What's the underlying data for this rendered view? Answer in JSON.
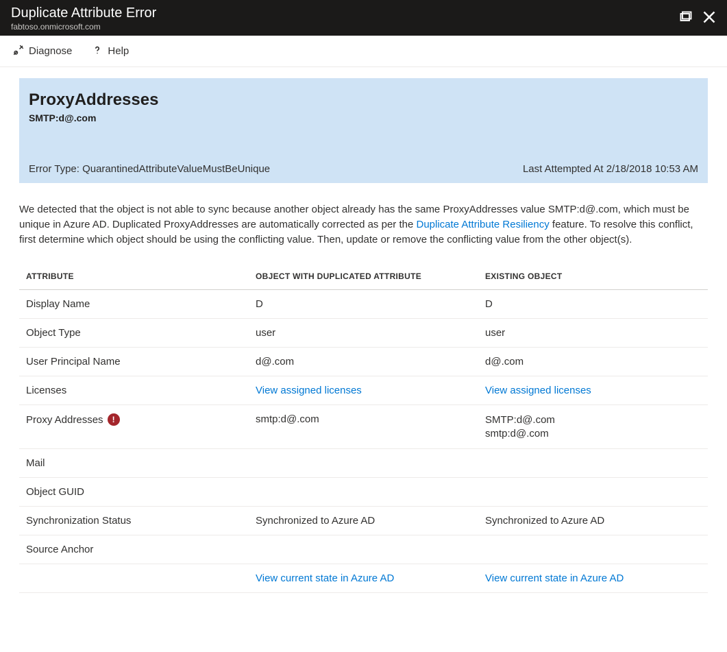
{
  "header": {
    "title": "Duplicate Attribute Error",
    "subtitle": "fabtoso.onmicrosoft.com"
  },
  "toolbar": {
    "diagnose": "Diagnose",
    "help": "Help"
  },
  "infoBox": {
    "heading": "ProxyAddresses",
    "sub": "SMTP:d@.com",
    "errorTypeLabel": "Error Type: QuarantinedAttributeValueMustBeUnique",
    "lastAttempted": "Last Attempted At 2/18/2018 10:53 AM"
  },
  "descriptionPart1": "We detected that the object is not able to sync because another object already has the same ProxyAddresses value SMTP:d@.com,                      which must be unique in Azure AD. Duplicated ProxyAddresses are automatically corrected as per the ",
  "descriptionLink": "Duplicate Attribute Resiliency",
  "descriptionPart2": " feature. To resolve this conflict, first determine which object should be using the conflicting value. Then, update or remove the conflicting value from the other object(s).",
  "table": {
    "headers": {
      "attribute": "ATTRIBUTE",
      "dup": "OBJECT WITH DUPLICATED ATTRIBUTE",
      "existing": "EXISTING OBJECT"
    },
    "rows": [
      {
        "attr": "Display Name",
        "error": false,
        "dup": "D",
        "exist": "D"
      },
      {
        "attr": "Object Type",
        "error": false,
        "dup": "user",
        "exist": "user"
      },
      {
        "attr": "User Principal Name",
        "error": false,
        "dup": "d@.com",
        "exist": "d@.com"
      },
      {
        "attr": "Licenses",
        "error": false,
        "dupLink": "View assigned licenses",
        "existLink": "View assigned licenses"
      },
      {
        "attr": "Proxy Addresses",
        "error": true,
        "dup": "smtp:d@.com",
        "existMulti": [
          "SMTP:d@.com",
          "smtp:d@.com"
        ]
      },
      {
        "attr": "Mail",
        "error": false,
        "dup": "",
        "exist": ""
      },
      {
        "attr": "Object GUID",
        "error": false,
        "dup": "",
        "exist": ""
      },
      {
        "attr": "Synchronization Status",
        "error": false,
        "dup": "Synchronized to Azure AD",
        "exist": "Synchronized to Azure AD"
      },
      {
        "attr": "Source Anchor",
        "error": false,
        "dup": "",
        "exist": ""
      },
      {
        "attr": "",
        "error": false,
        "dupLink": "View current state in Azure AD",
        "existLink": "View current state in Azure AD"
      }
    ]
  }
}
